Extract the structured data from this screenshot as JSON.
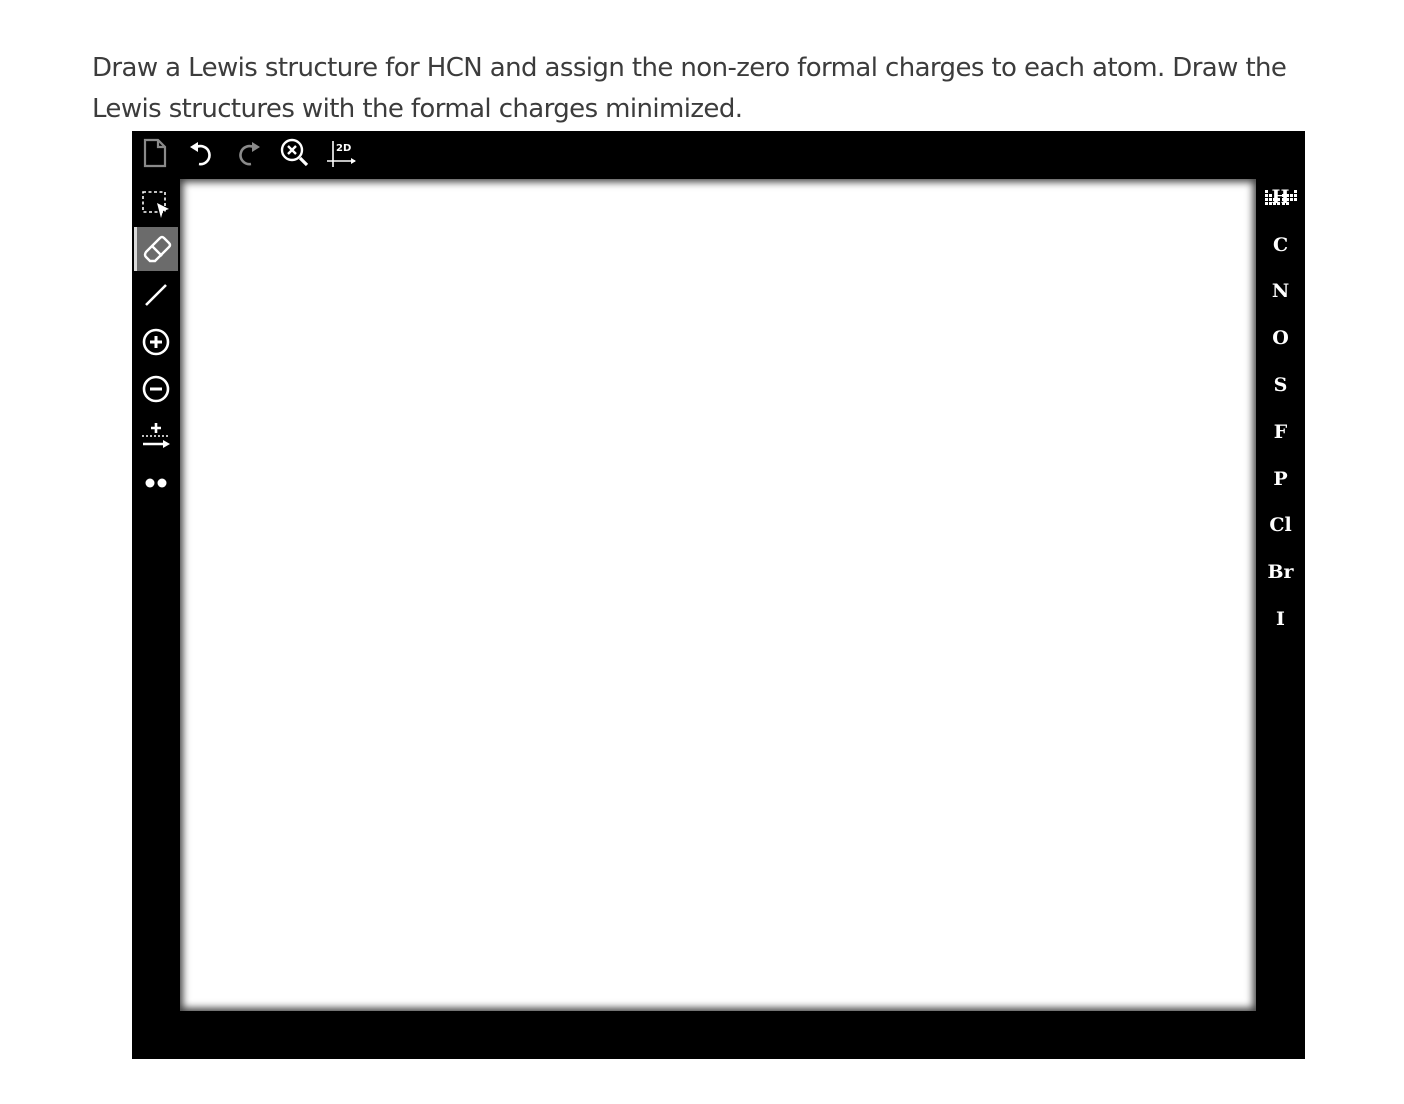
{
  "question": {
    "line1": "Draw a Lewis structure for HCN and assign the non-zero formal charges to each atom.  Draw the",
    "line2": "Lewis structures with the formal charges minimized."
  },
  "top_toolbar": {
    "icons": [
      "new-document-icon",
      "undo-icon",
      "redo-icon",
      "zoom-clear-icon",
      "2d-clean-icon"
    ],
    "clean_2d_label": "2D"
  },
  "left_toolbar": {
    "icons": [
      "lasso-select-icon",
      "eraser-icon",
      "single-bond-icon",
      "positive-charge-icon",
      "negative-charge-icon",
      "charge-arrow-icon",
      "lone-pair-icon"
    ],
    "active_tool": "eraser"
  },
  "elements": [
    "H",
    "C",
    "N",
    "O",
    "S",
    "F",
    "P",
    "Cl",
    "Br",
    "I"
  ],
  "colors": {
    "toolbar_bg": "#000000",
    "canvas_bg": "#ffffff",
    "question_text": "#3c3c3c",
    "active_tool_bg": "#6b6b6b"
  }
}
